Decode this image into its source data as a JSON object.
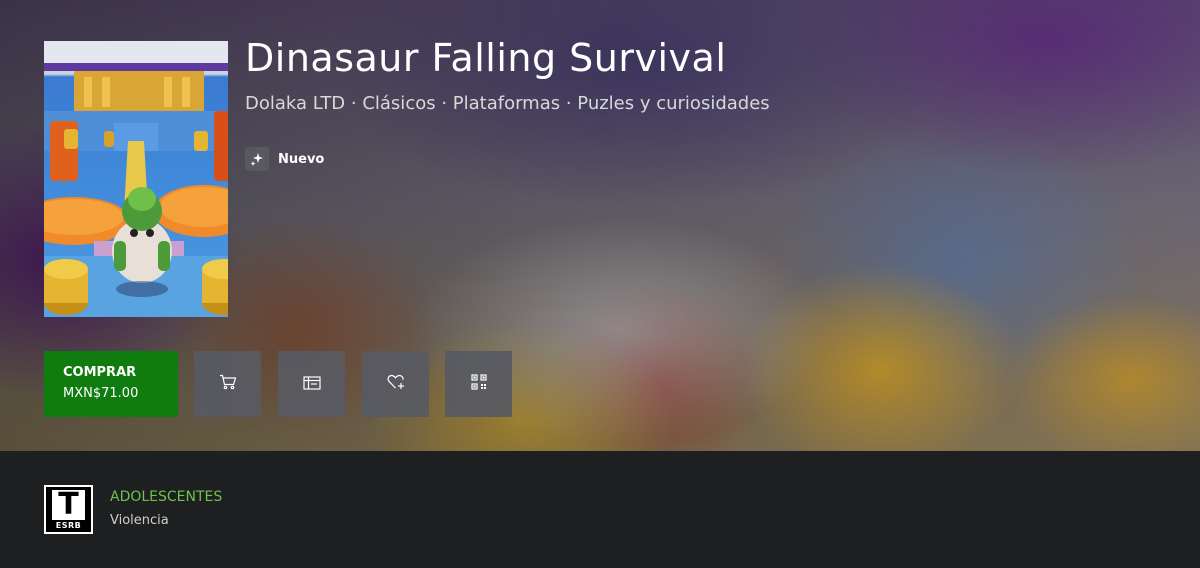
{
  "product": {
    "title": "Dinasaur Falling Survival",
    "meta": "Dolaka LTD · Clásicos · Plataformas · Puzles y curiosidades",
    "badge_label": "Nuevo",
    "badge_icon": "sparkle-icon"
  },
  "actions": {
    "buy_label": "COMPRAR",
    "buy_price": "MXN$71.00",
    "buy_color": "#107c10",
    "icons": [
      "cart-icon",
      "gift-card-icon",
      "wishlist-heart-icon",
      "qr-code-icon"
    ]
  },
  "rating": {
    "board": "ESRB",
    "letter": "T",
    "name": "ADOLESCENTES",
    "descriptor": "Violencia",
    "name_color": "#6cc24a"
  }
}
